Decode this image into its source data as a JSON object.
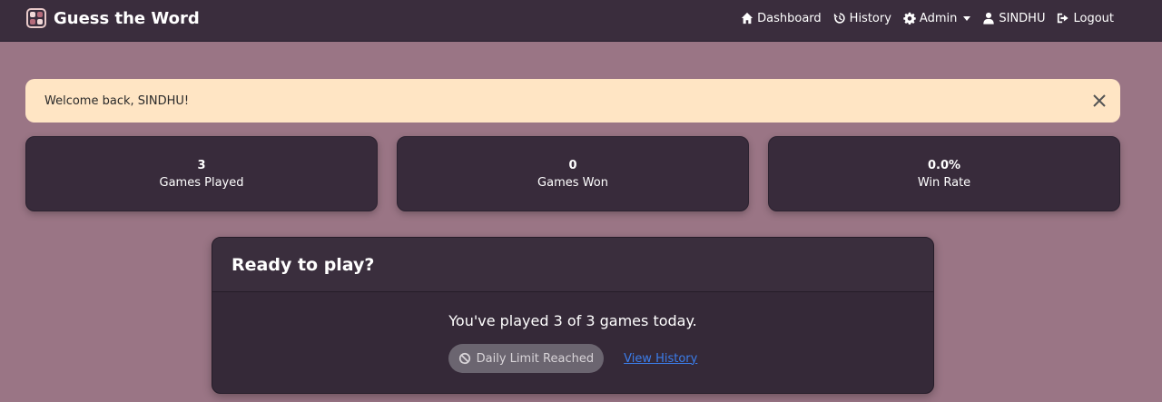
{
  "app": {
    "title": "Guess the Word"
  },
  "nav": {
    "items": [
      {
        "label": "Dashboard",
        "icon": "home-icon"
      },
      {
        "label": "History",
        "icon": "history-icon"
      },
      {
        "label": "Admin",
        "icon": "gear-icon"
      },
      {
        "label": "SINDHU",
        "icon": "user-icon"
      },
      {
        "label": "Logout",
        "icon": "logout-icon"
      }
    ]
  },
  "alert": {
    "message": "Welcome back, SINDHU!"
  },
  "stats": [
    {
      "value": "3",
      "label": "Games Played"
    },
    {
      "value": "0",
      "label": "Games Won"
    },
    {
      "value": "0.0%",
      "label": "Win Rate"
    }
  ],
  "play_card": {
    "title": "Ready to play?",
    "message": "You've played 3 of 3 games today.",
    "limit_label": "Daily Limit Reached",
    "history_link": "View History"
  },
  "colors": {
    "background": "#9a7585",
    "navbar": "#3a2d3d",
    "alert": "#ffe5c4",
    "card": "#382b3b",
    "link": "#3b7dea"
  }
}
